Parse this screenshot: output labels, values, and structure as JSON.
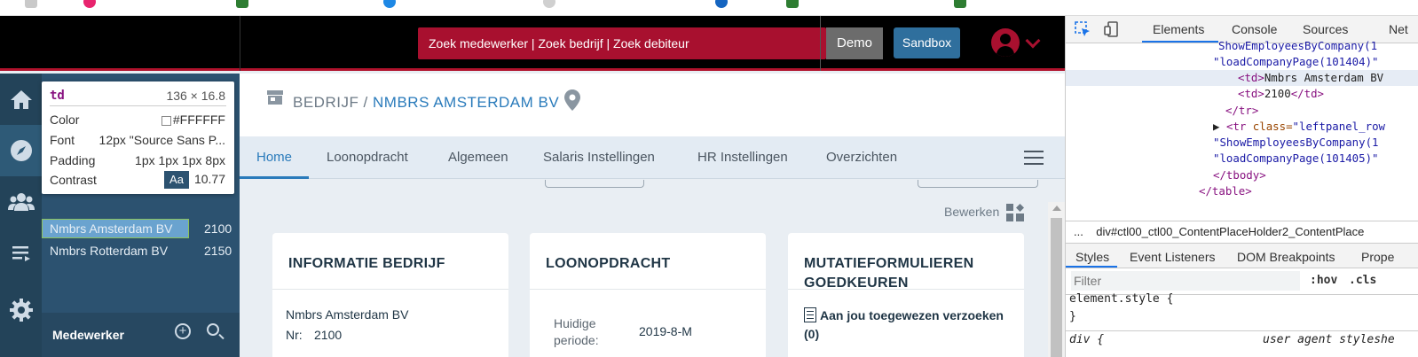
{
  "header": {
    "search_text": "Zoek medewerker | Zoek bedrijf | Zoek debiteur",
    "demo_label": "Demo",
    "sandbox_label": "Sandbox"
  },
  "colors": {
    "brand_red": "#a8102f",
    "sidebar_blue": "#2c5270",
    "accent_blue": "#2a7bbb",
    "sandbox_blue": "#2f6f9d"
  },
  "rail_icons": [
    "home-icon",
    "compass-icon",
    "users-icon",
    "list-icon",
    "gear-icon"
  ],
  "tooltip": {
    "tag": "td",
    "size": "136 × 16.8",
    "color_label": "Color",
    "color_value": "#FFFFFF",
    "font_label": "Font",
    "font_value": "12px \"Source Sans P...",
    "padding_label": "Padding",
    "padding_value": "1px 1px 1px 8px",
    "contrast_label": "Contrast",
    "contrast_badge": "Aa",
    "contrast_value": "10.77"
  },
  "companies": [
    {
      "name": "Nmbrs Amsterdam BV",
      "number": "2100",
      "selected": true
    },
    {
      "name": "Nmbrs Rotterdam BV",
      "number": "2150",
      "selected": false
    }
  ],
  "panel_footer": {
    "label": "Medewerker"
  },
  "page": {
    "title_prefix": "BEDRIJF / ",
    "company": "NMBRS AMSTERDAM BV",
    "tabs": [
      "Home",
      "Loonopdracht",
      "Algemeen",
      "Salaris Instellingen",
      "HR Instellingen",
      "Overzichten"
    ],
    "edit_label": "Bewerken"
  },
  "cards": {
    "info": {
      "title": "INFORMATIE BEDRIJF",
      "name": "Nmbrs Amsterdam BV",
      "nr_label": "Nr:",
      "nr_value": "2100"
    },
    "payroll": {
      "title": "LOONOPDRACHT",
      "period_label_1": "Huidige",
      "period_label_2": "periode:",
      "period_value": "2019-8-M"
    },
    "mutations": {
      "title_1": "MUTATIEFORMULIEREN",
      "title_2": "GOEDKEUREN",
      "assigned_label": "Aan jou toegewezen verzoeken",
      "assigned_count": "(0)"
    }
  },
  "devtools": {
    "tabs": [
      "Elements",
      "Console",
      "Sources",
      "Net"
    ],
    "code": {
      "l1": "ShowEmployeesByCompany(1",
      "l2a": "\"loadCompanyPage(101404)\"",
      "l3_open": "<td>",
      "l3_text": "Nmbrs Amsterdam BV",
      "l4_open": "<td>",
      "l4_text": "2100",
      "l4_close": "</td>",
      "l5": "</tr>",
      "l6_tag": "<tr ",
      "l6_attr": "class=",
      "l6_val": "\"leftpanel_row",
      "l7": "\"ShowEmployeesByCompany(1",
      "l8": "\"loadCompanyPage(101405)\"",
      "l9": "</tbody>",
      "l10": "</table>"
    },
    "crumb_dots": "...",
    "crumb": "div#ctl00_ctl00_ContentPlaceHolder2_ContentPlace",
    "subtabs": [
      "Styles",
      "Event Listeners",
      "DOM Breakpoints",
      "Prope"
    ],
    "filter_placeholder": "Filter",
    "hov": ":hov",
    "cls": ".cls",
    "rule1": "element.style {",
    "rule1_close": "}",
    "rule2": "div {",
    "ua": "user agent styleshe"
  }
}
